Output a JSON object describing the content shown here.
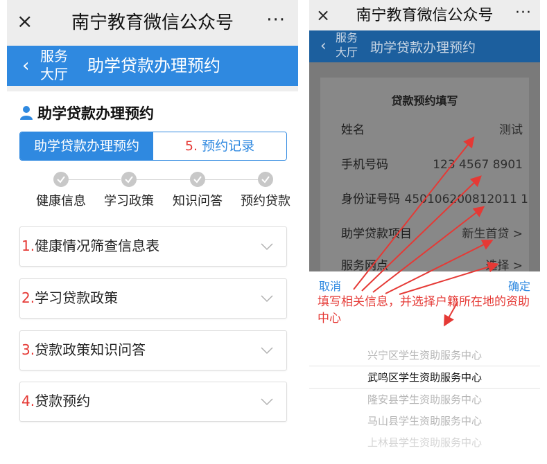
{
  "left": {
    "wechat": {
      "close": "×",
      "title": "南宁教育微信公众号",
      "more": "···"
    },
    "header": {
      "back_label": "服务大厅",
      "title": "助学贷款办理预约"
    },
    "section_title": "助学贷款办理预约",
    "tabs": {
      "active": "助学贷款办理预约",
      "inactive_num": "5.",
      "inactive": "预约记录"
    },
    "steps": [
      "健康信息",
      "学习政策",
      "知识问答",
      "预约贷款"
    ],
    "items": [
      {
        "num": "1.",
        "label": "健康情况筛查信息表"
      },
      {
        "num": "2.",
        "label": "学习贷款政策"
      },
      {
        "num": "3.",
        "label": "贷款政策知识问答"
      },
      {
        "num": "4.",
        "label": "贷款预约"
      }
    ]
  },
  "right": {
    "wechat": {
      "close": "×",
      "title": "南宁教育微信公众号",
      "more": "···"
    },
    "header": {
      "back_label": "服务大厅",
      "title": "助学贷款办理预约"
    },
    "form": {
      "heading": "贷款预约填写",
      "rows": [
        {
          "label": "姓名",
          "value": "测试"
        },
        {
          "label": "手机号码",
          "value": "123 4567 8901"
        },
        {
          "label": "身份证号码",
          "value": "450106200812011 1"
        },
        {
          "label": "助学贷款项目",
          "value": "新生首贷 >"
        },
        {
          "label": "服务网点",
          "value": "选择 >"
        }
      ]
    },
    "sheet": {
      "cancel": "取消",
      "confirm": "确定",
      "annotation": "填写相关信息，并选择户籍所在地的资助中心",
      "options": [
        "兴宁区学生资助服务中心",
        "武鸣区学生资助服务中心",
        "隆安县学生资助服务中心",
        "马山县学生资助服务中心",
        "上林县学生资助服务中心"
      ]
    }
  },
  "colors": {
    "brand_blue": "#2f89e0",
    "annotation_red": "#e53935"
  }
}
